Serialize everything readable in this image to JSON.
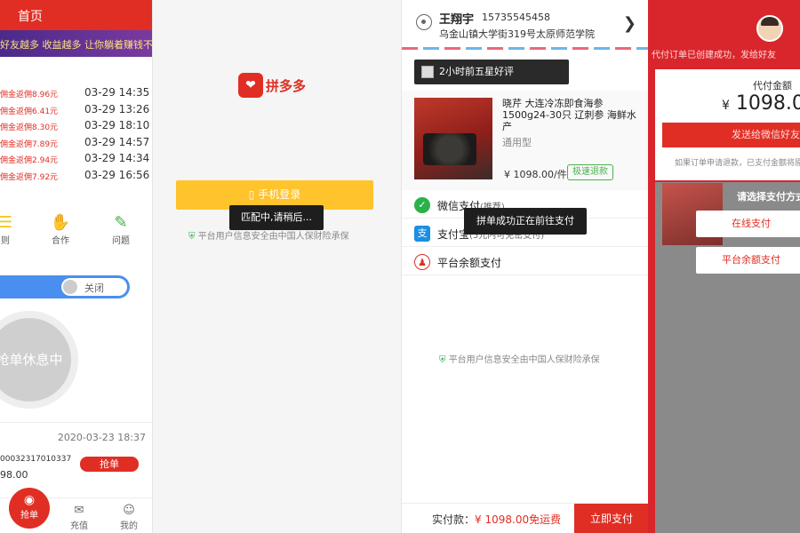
{
  "panel1": {
    "header_title": "首页",
    "marquee": "好友越多 收益越多 让你躺着赚钱不再是梦",
    "rows": [
      {
        "rebate": "佣金返佣8.96元",
        "time": "03-29 14:35"
      },
      {
        "rebate": "佣金返佣6.41元",
        "time": "03-29 13:26"
      },
      {
        "rebate": "佣金返佣8.30元",
        "time": "03-29 18:10"
      },
      {
        "rebate": "佣金返佣7.89元",
        "time": "03-29 14:57"
      },
      {
        "rebate": "佣金返佣2.94元",
        "time": "03-29 14:34"
      },
      {
        "rebate": "佣金返佣7.92元",
        "time": "03-29 16:56"
      }
    ],
    "icons": [
      {
        "label": "则",
        "icon": "list-icon"
      },
      {
        "label": "合作",
        "icon": "handshake-icon"
      },
      {
        "label": "问题",
        "icon": "question-icon"
      }
    ],
    "toggle_label": "关闭",
    "rest_label": "抢单休息中",
    "order": {
      "date": "2020-03-23 18:37",
      "number": "00032317010337",
      "amount": "98.00",
      "grab_label": "抢单"
    },
    "nav": {
      "grab": "抢单",
      "recharge": "充值",
      "mine": "我的"
    }
  },
  "panel2": {
    "logo_text": "拼多多",
    "login_label": "手机登录",
    "toast": "匹配中,请稍后...",
    "security": "平台用户信息安全由中国人保财险承保"
  },
  "panel3": {
    "name": "王翔宇",
    "phone": "15735545458",
    "address": "乌金山镇大学街319号太原师范学院",
    "badge": "2小时前五星好评",
    "product": {
      "title": "晓芹 大连冷冻即食海参1500g24-30只 辽刺参 海鲜水产",
      "spec": "通用型",
      "price": "¥ 1098.00/件",
      "refund": "极速退款"
    },
    "payments": [
      {
        "label": "微信支付",
        "sub": "(推荐)",
        "icon": "wechat-pay-icon",
        "color": "#2bb14a",
        "glyph": "✓"
      },
      {
        "label": "支付宝",
        "sub": "(5元内可免密支付)",
        "icon": "alipay-icon",
        "color": "#1a8fe3",
        "glyph": "支"
      },
      {
        "label": "平台余额支付",
        "sub": "",
        "icon": "balance-user-icon",
        "color": "#e02e24",
        "glyph": "♟"
      }
    ],
    "toast": "拼单成功正在前往支付",
    "security": "平台用户信息安全由中国人保财险承保",
    "total_label": "实付款：",
    "total_amount": "¥ 1098.00",
    "shipping": "免运费",
    "pay_button": "立即支付"
  },
  "panel4": {
    "message": "代付订单已创建成功，发给好友",
    "amount_label": "代付金额",
    "currency": "¥",
    "amount": "1098.0",
    "share_label": "发送给微信好友",
    "note": "如果订单申请退款，已支付金额将原",
    "select_label": "请选择支付方式",
    "online_pay": "在线支付",
    "balance_pay": "平台余额支付"
  }
}
